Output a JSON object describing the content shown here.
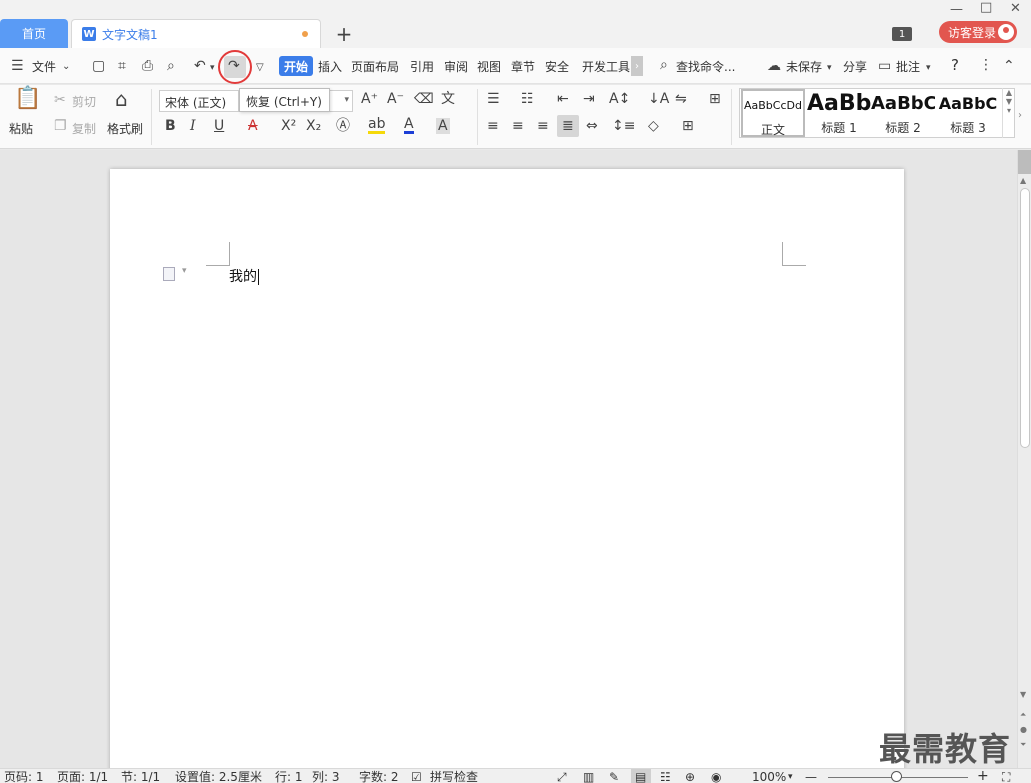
{
  "titlebar": {
    "home_tab": "首页",
    "doc_tab": "文字文稿1",
    "doc_icon": "W",
    "add_tab": "+",
    "minimize": "—",
    "maximize": "□",
    "close": "✕",
    "window_count": "1",
    "login_label": "访客登录"
  },
  "menubar": {
    "file": "文件",
    "start": "开始",
    "tabs": [
      "插入",
      "页面布局",
      "引用",
      "审阅",
      "视图",
      "章节",
      "安全",
      "开发工具"
    ],
    "search": "查找命令...",
    "unsaved": "未保存",
    "share": "分享",
    "comment": "批注",
    "help": "?"
  },
  "ribbon": {
    "paste": "粘贴",
    "cut": "剪切",
    "copy": "复制",
    "format_painter": "格式刷",
    "font_name": "宋体 (正文)",
    "tooltip": "恢复 (Ctrl+Y)",
    "styles": [
      {
        "sample": "AaBbCcDd",
        "name": "正文"
      },
      {
        "sample": "AaBb",
        "name": "标题 1"
      },
      {
        "sample": "AaBbC",
        "name": "标题 2"
      },
      {
        "sample": "AaBbC",
        "name": "标题 3"
      }
    ]
  },
  "document": {
    "text": "我的"
  },
  "watermark": "最需教育",
  "statusbar": {
    "page_num": "页码: 1",
    "pages": "页面: 1/1",
    "section": "节: 1/1",
    "setting": "设置值: 2.5厘米",
    "row": "行: 1",
    "col": "列: 3",
    "words": "字数: 2",
    "spell": "拼写检查",
    "zoom": "100%",
    "zoom_out": "—",
    "zoom_in": "+"
  },
  "colors": {
    "accent": "#3b7de9",
    "home_tab": "#5a9bf5",
    "login": "#e2564f",
    "highlight_circle": "#e23a3a"
  }
}
